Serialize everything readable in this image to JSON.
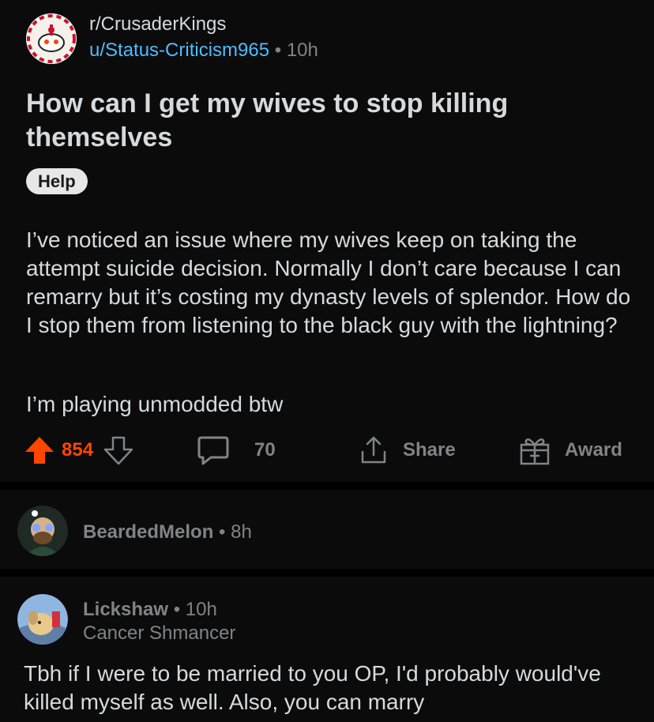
{
  "post": {
    "subreddit": "r/CrusaderKings",
    "author": "u/Status-Criticism965",
    "separator": "•",
    "age": "10h",
    "title": "How can I get my wives to stop killing themselves",
    "flair": "Help",
    "body_paragraph_1": "I’ve noticed an issue where my wives keep on taking the attempt suicide decision. Normally I don’t care because I can remarry but it’s costing my dynasty levels of splendor. How do I stop them from listening to the black guy with the lightning?",
    "body_paragraph_2": "I’m playing unmodded btw",
    "upvotes": "854",
    "comments": "70",
    "share_label": "Share",
    "award_label": "Award"
  },
  "comments": [
    {
      "author": "BeardedMelon",
      "separator": "•",
      "age": "8h"
    },
    {
      "author": "Lickshaw",
      "separator": "•",
      "age": "10h",
      "user_flair": "Cancer Shmancer",
      "text": "Tbh if I were to be married to you OP, I'd probably would've killed myself as well. Also, you can marry"
    }
  ],
  "colors": {
    "background": "#000000",
    "card": "#0b0b0c",
    "text": "#d7dadc",
    "muted": "#818384",
    "username_link": "#4fbcff",
    "upvote_active": "#ff4500"
  },
  "icons": {
    "subreddit_avatar": "snoo-crusader-icon",
    "upvote": "upvote-arrow-icon",
    "downvote": "downvote-arrow-icon",
    "comment": "comment-bubble-icon",
    "share": "share-icon",
    "award": "gift-award-icon"
  }
}
